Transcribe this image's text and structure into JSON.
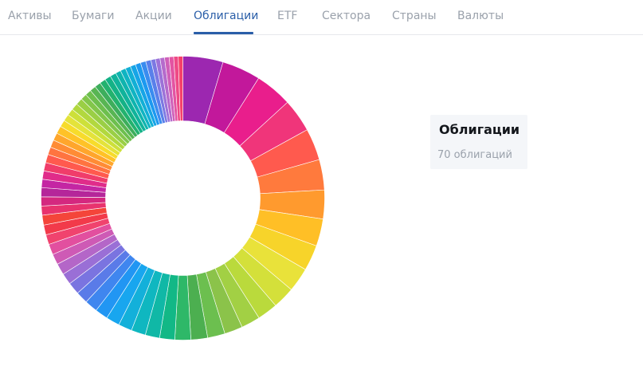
{
  "tabs": [
    {
      "label": "Активы",
      "active": false
    },
    {
      "label": "Бумаги",
      "active": false
    },
    {
      "label": "Акции",
      "active": false
    },
    {
      "label": "Облигации",
      "active": true
    },
    {
      "label": "ETF",
      "active": false
    },
    {
      "label": "Сектора",
      "active": false
    },
    {
      "label": "Страны",
      "active": false
    },
    {
      "label": "Валюты",
      "active": false
    }
  ],
  "accent_color": "#2a5ea8",
  "summary": {
    "title": "Облигации",
    "count_label": "70 облигаций"
  },
  "chart_data": {
    "type": "pie",
    "variant": "donut",
    "segment_count": 70,
    "values": [
      5.3,
      5.1,
      4.9,
      4.4,
      4.2,
      4.0,
      3.8,
      3.6,
      3.4,
      3.2,
      2.9,
      2.7,
      2.5,
      2.4,
      2.3,
      2.2,
      2.1,
      2.0,
      1.9,
      1.9,
      1.8,
      1.8,
      1.7,
      1.7,
      1.6,
      1.6,
      1.5,
      1.5,
      1.4,
      1.4,
      1.3,
      1.3,
      1.3,
      1.2,
      1.2,
      1.2,
      1.1,
      1.1,
      1.1,
      1.1,
      1.0,
      1.0,
      1.0,
      1.0,
      0.9,
      0.9,
      0.9,
      0.9,
      0.9,
      0.8,
      0.8,
      0.8,
      0.8,
      0.8,
      0.8,
      0.8,
      0.7,
      0.7,
      0.7,
      0.7,
      0.7,
      0.7,
      0.7,
      0.6,
      0.6,
      0.6,
      0.6,
      0.6,
      0.6,
      0.6
    ],
    "palette": [
      "#9c27b0",
      "#c2189b",
      "#e91e8c",
      "#f0357a",
      "#ff5a4e",
      "#ff7a3d",
      "#ff9a2e",
      "#ffbf26",
      "#f7d42a",
      "#e9e23a",
      "#d4e03a",
      "#bada3c",
      "#a2d044",
      "#8bc34a",
      "#6cbf4f",
      "#4caf50",
      "#2eb868",
      "#12b886",
      "#10b8a6",
      "#0fb7c0",
      "#13b0da",
      "#18a6ef",
      "#2196f3",
      "#3f86ef",
      "#5a7be8",
      "#7a74e0",
      "#9a6fd6",
      "#b466c8",
      "#ce5ab5",
      "#e24f9f",
      "#f0436e",
      "#f23a4a",
      "#f4453a",
      "#e8336e",
      "#d4287f",
      "#b5269a",
      "#c426a3",
      "#e02c8a",
      "#f03d6a",
      "#ff5a4e",
      "#ff7440",
      "#ff8c35",
      "#ffa62c",
      "#ffc227",
      "#f7dc2b",
      "#e4e33a",
      "#cde03a",
      "#b2d83e",
      "#9acf45",
      "#82c64b",
      "#6dbf4e",
      "#58b553",
      "#3dae5c",
      "#23b26e",
      "#14b286",
      "#10b39b",
      "#0fb4ae",
      "#10b4c2",
      "#12afd5",
      "#16a5e6",
      "#1c99f0",
      "#3a8cef",
      "#5a80ea",
      "#7c78e2",
      "#9c72d8",
      "#b56bcc",
      "#cf60b9",
      "#e354a2",
      "#ee4a86",
      "#f6406a"
    ]
  }
}
